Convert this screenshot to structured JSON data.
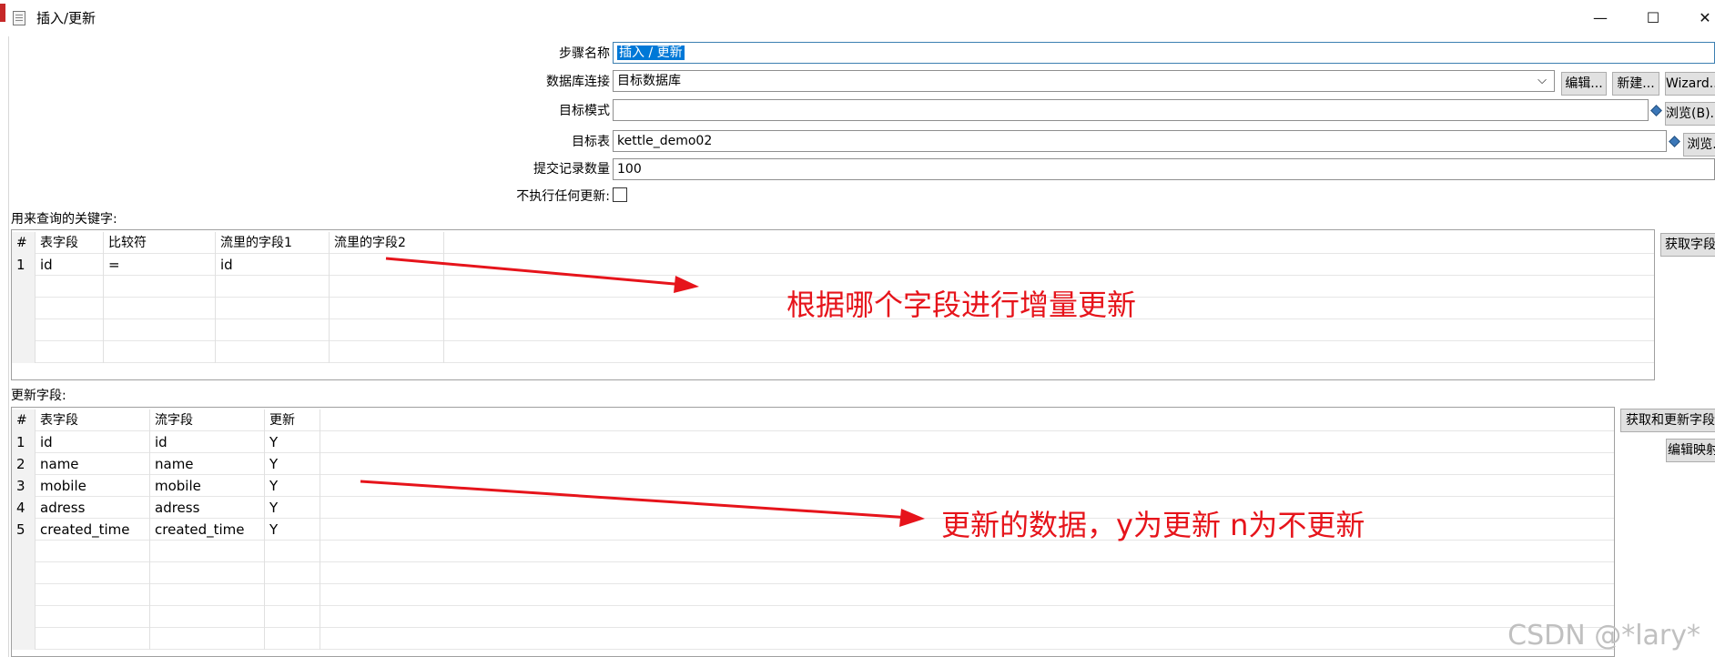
{
  "window": {
    "title": "插入/更新",
    "minimize": "—",
    "maximize": "☐",
    "close": "✕"
  },
  "form": {
    "step_name_label": "步骤名称",
    "step_name_value": "插入 / 更新",
    "connection_label": "数据库连接",
    "connection_value": "目标数据库",
    "edit_button": "编辑...",
    "new_button": "新建...",
    "wizard_button": "Wizard...",
    "schema_label": "目标模式",
    "schema_value": "",
    "browse_b_button": "浏览(B)...",
    "table_label": "目标表",
    "table_value": "kettle_demo02",
    "browse_button": "浏览...",
    "commit_label": "提交记录数量",
    "commit_value": "100",
    "no_update_label": "不执行任何更新:",
    "no_update_checked": false
  },
  "key_section": {
    "label": "用来查询的关键字:",
    "columns": [
      "#",
      "表字段",
      "比较符",
      "流里的字段1",
      "流里的字段2"
    ],
    "rows": [
      [
        "1",
        "id",
        "=",
        "id",
        ""
      ]
    ],
    "get_fields_button": "获取字段"
  },
  "update_section": {
    "label": "更新字段:",
    "columns": [
      "#",
      "表字段",
      "流字段",
      "更新"
    ],
    "rows": [
      [
        "1",
        "id",
        "id",
        "Y"
      ],
      [
        "2",
        "name",
        "name",
        "Y"
      ],
      [
        "3",
        "mobile",
        "mobile",
        "Y"
      ],
      [
        "4",
        "adress",
        "adress",
        "Y"
      ],
      [
        "5",
        "created_time",
        "created_time",
        "Y"
      ]
    ],
    "get_update_fields_button": "获取和更新字段",
    "edit_mapping_button": "编辑映射"
  },
  "annotations": {
    "key_note": "根据哪个字段进行增量更新",
    "update_note": "更新的数据，y为更新 n为不更新",
    "color": "#e6141b"
  },
  "watermark": "CSDN @*lary*"
}
